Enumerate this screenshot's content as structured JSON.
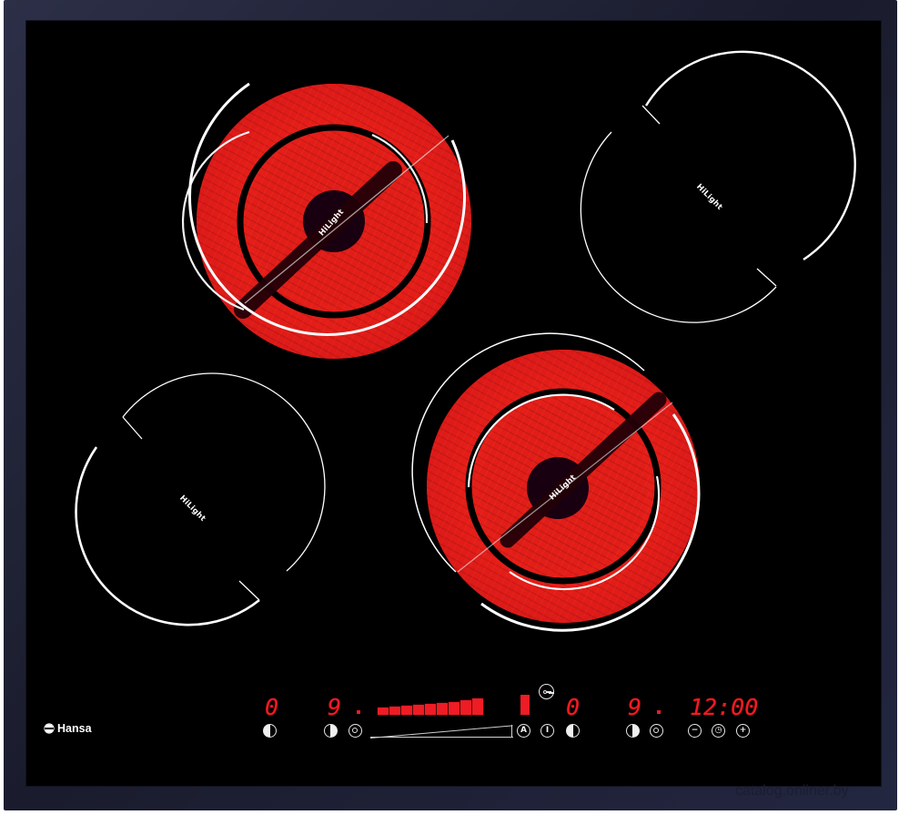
{
  "product": {
    "brand_name": "Hansa",
    "zone_label": "HiLight",
    "watermark": "catalog.onliner.by",
    "background_color": "#000000",
    "frame_color": "#1f2137",
    "heat_color": "#e31f21"
  },
  "control_panel": {
    "left_zone_level": "0",
    "left_active_level": "9",
    "right_zone_level": "0",
    "right_active_level": "9",
    "timer": "12:00",
    "icons": [
      "left-zone-select-icon",
      "front-zone-select-icon",
      "dual-zone-icon",
      "auto-icon",
      "power-icon",
      "rear-zone-select-icon",
      "right-zone-select-icon",
      "right-dual-zone-icon",
      "minus-icon",
      "timer-icon",
      "plus-icon",
      "lock-key-icon"
    ],
    "auto_label": "A",
    "power_label": "I",
    "minus_label": "−",
    "plus_label": "+"
  },
  "zones": [
    {
      "name": "rear-left-zone",
      "state": "active",
      "label": "HiLight"
    },
    {
      "name": "rear-right-zone",
      "state": "inactive",
      "label": "HiLight"
    },
    {
      "name": "front-left-zone",
      "state": "inactive",
      "label": "HiLight"
    },
    {
      "name": "front-right-zone",
      "state": "active",
      "label": "HiLight"
    }
  ]
}
